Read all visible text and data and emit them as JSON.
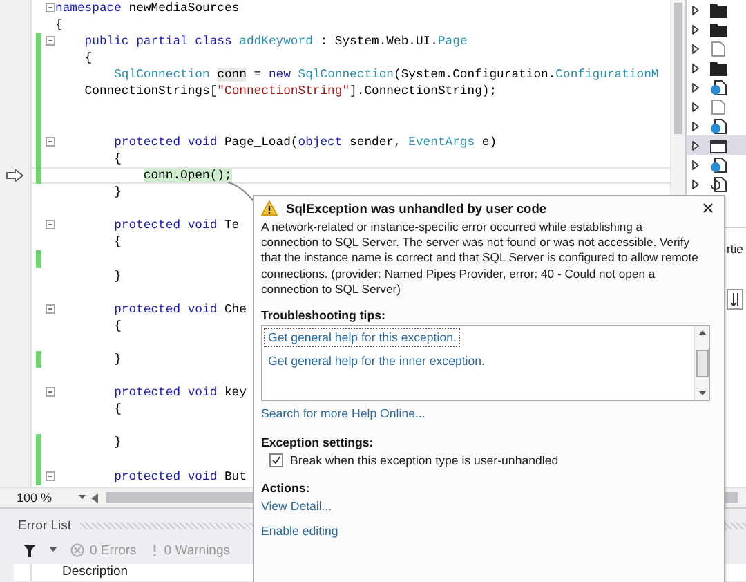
{
  "editor": {
    "lines": [
      {
        "tokens": [
          {
            "kind": "keyword",
            "text": "namespace"
          },
          {
            "kind": "plain",
            "text": " newMediaSources"
          }
        ],
        "changed": false,
        "foldable": true,
        "current": false
      },
      {
        "tokens": [
          {
            "kind": "plain",
            "text": "{"
          }
        ],
        "changed": false,
        "foldable": false,
        "current": false,
        "children": [
          {
            "tokens": [
              {
                "kind": "keyword",
                "text": "public partial class"
              },
              {
                "kind": "type",
                "text": " addKeyword"
              },
              {
                "kind": "plain",
                "text": " : System.Web.UI."
              },
              {
                "kind": "type",
                "text": "Page"
              }
            ],
            "changed": true,
            "foldable": true,
            "current": false
          },
          {
            "tokens": [
              {
                "kind": "plain",
                "text": "{"
              }
            ],
            "changed": true,
            "foldable": false,
            "current": false,
            "children": [
              {
                "tokens": [
                  {
                    "kind": "type",
                    "text": "SqlConnection "
                  },
                  {
                    "kind": "highlight",
                    "text": "conn"
                  },
                  {
                    "kind": "plain",
                    "text": " = "
                  },
                  {
                    "kind": "keyword",
                    "text": "new"
                  },
                  {
                    "kind": "type",
                    "text": " SqlConnection"
                  },
                  {
                    "kind": "plain",
                    "text": "(System.Configuration."
                  },
                  {
                    "kind": "type",
                    "text": "ConfigurationM"
                  }
                ],
                "changed": true,
                "foldable": false,
                "current": false
              }
            ]
          },
          {
            "tokens": [
              {
                "kind": "plain",
                "text": "ConnectionStrings["
              },
              {
                "kind": "string",
                "text": "\"ConnectionString\""
              },
              {
                "kind": "plain",
                "text": "].ConnectionString);"
              }
            ],
            "changed": true,
            "foldable": false,
            "current": false,
            "children": [
              {
                "changed": true,
                "foldable": false,
                "current": false
              },
              {
                "changed": true,
                "foldable": false,
                "current": false
              },
              {
                "tokens": [
                  {
                    "kind": "keyword",
                    "text": "protected void"
                  },
                  {
                    "kind": "plain",
                    "text": " Page_Load("
                  },
                  {
                    "kind": "keyword",
                    "text": "object"
                  },
                  {
                    "kind": "plain",
                    "text": " sender, "
                  },
                  {
                    "kind": "type",
                    "text": "EventArgs"
                  },
                  {
                    "kind": "plain",
                    "text": " e)"
                  }
                ],
                "changed": true,
                "foldable": true,
                "current": false
              },
              {
                "tokens": [
                  {
                    "kind": "plain",
                    "text": "{"
                  }
                ],
                "changed": true,
                "foldable": false,
                "current": false,
                "children": [
                  {
                    "tokens": [
                      {
                        "kind": "statement",
                        "text": "conn.Open();"
                      }
                    ],
                    "changed": true,
                    "foldable": false,
                    "current": true
                  }
                ]
              },
              {
                "tokens": [
                  {
                    "kind": "plain",
                    "text": "}"
                  }
                ],
                "changed": false,
                "foldable": false,
                "current": false
              },
              {
                "changed": false,
                "foldable": false,
                "current": false
              },
              {
                "tokens": [
                  {
                    "kind": "keyword",
                    "text": "protected void"
                  },
                  {
                    "kind": "plain",
                    "text": " Te"
                  }
                ],
                "changed": false,
                "foldable": true,
                "current": false
              },
              {
                "tokens": [
                  {
                    "kind": "plain",
                    "text": "{"
                  }
                ],
                "changed": false,
                "foldable": false,
                "current": false,
                "children": [
                  {
                    "changed": true,
                    "foldable": false,
                    "current": false
                  }
                ]
              },
              {
                "tokens": [
                  {
                    "kind": "plain",
                    "text": "}"
                  }
                ],
                "changed": false,
                "foldable": false,
                "current": false
              },
              {
                "changed": false,
                "foldable": false,
                "current": false
              },
              {
                "tokens": [
                  {
                    "kind": "keyword",
                    "text": "protected void"
                  },
                  {
                    "kind": "plain",
                    "text": " Che"
                  }
                ],
                "changed": false,
                "foldable": true,
                "current": false
              },
              {
                "tokens": [
                  {
                    "kind": "plain",
                    "text": "{"
                  }
                ],
                "changed": false,
                "foldable": false,
                "current": false,
                "children": [
                  {
                    "changed": false,
                    "foldable": false,
                    "current": false
                  }
                ]
              },
              {
                "tokens": [
                  {
                    "kind": "plain",
                    "text": "}"
                  }
                ],
                "changed": true,
                "foldable": false,
                "current": false
              },
              {
                "changed": false,
                "foldable": false,
                "current": false
              },
              {
                "tokens": [
                  {
                    "kind": "keyword",
                    "text": "protected void"
                  },
                  {
                    "kind": "plain",
                    "text": " key"
                  }
                ],
                "changed": false,
                "foldable": true,
                "current": false
              },
              {
                "tokens": [
                  {
                    "kind": "plain",
                    "text": "{"
                  }
                ],
                "changed": false,
                "foldable": false,
                "current": false,
                "children": [
                  {
                    "changed": false,
                    "foldable": false,
                    "current": false
                  }
                ]
              },
              {
                "tokens": [
                  {
                    "kind": "plain",
                    "text": "}"
                  }
                ],
                "changed": true,
                "foldable": false,
                "current": false
              },
              {
                "changed": true,
                "foldable": false,
                "current": false
              },
              {
                "tokens": [
                  {
                    "kind": "keyword",
                    "text": "protected void"
                  },
                  {
                    "kind": "plain",
                    "text": " But"
                  }
                ],
                "changed": true,
                "foldable": true,
                "current": false
              }
            ]
          }
        ]
      }
    ],
    "zoom": "100 %"
  },
  "solution_tree": {
    "items": [
      {
        "kind": "folder-dark",
        "selected": false
      },
      {
        "kind": "folder-dark",
        "selected": false
      },
      {
        "kind": "page",
        "selected": false
      },
      {
        "kind": "folder-dark",
        "selected": false
      },
      {
        "kind": "web",
        "selected": false
      },
      {
        "kind": "page",
        "selected": false
      },
      {
        "kind": "web",
        "selected": false
      },
      {
        "kind": "window",
        "selected": true
      },
      {
        "kind": "web",
        "selected": false
      },
      {
        "kind": "refresh",
        "selected": false
      }
    ]
  },
  "properties_panel": {
    "title": "rtie"
  },
  "error_list": {
    "title": "Error List",
    "filters": [
      {
        "kind": "error",
        "label": "0 Errors",
        "disabled": true
      },
      {
        "kind": "warning",
        "label": "0 Warnings",
        "disabled": true
      }
    ],
    "columns": [
      "Description"
    ]
  },
  "exception_popup": {
    "title": "SqlException was unhandled by user code",
    "message": "A network-related or instance-specific error occurred while establishing a connection to SQL Server. The server was not found or was not accessible. Verify that the instance name is correct and that SQL Server is configured to allow remote connections. (provider: Named Pipes Provider, error: 40 - Could not open a connection to SQL Server)",
    "tips_heading": "Troubleshooting tips:",
    "tips": [
      {
        "label": "Get general help for this exception.",
        "selected": true
      },
      {
        "label": "Get general help for the inner exception.",
        "selected": false
      }
    ],
    "search_link": "Search for more Help Online...",
    "settings_heading": "Exception settings:",
    "settings": [
      {
        "label": "Break when this exception type is user-unhandled",
        "checked": true
      }
    ],
    "actions_heading": "Actions:",
    "actions": [
      "View Detail...",
      "Enable editing"
    ]
  }
}
